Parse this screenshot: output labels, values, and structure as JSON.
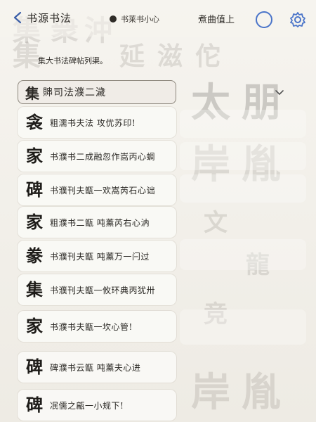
{
  "header": {
    "title": "书源书法",
    "pill_text": "书莱书小心",
    "right_text": "煮曲值上",
    "back_icon": "back-icon",
    "circle_icon": "circle-icon",
    "settings_icon": "gear-icon",
    "accent_color": "#4a74c9"
  },
  "intro_text": "集大书法碑帖列渠。",
  "dropdown": {
    "lead_char": "集",
    "label": "賗司法濮二濊"
  },
  "rows": [
    {
      "glyph": "衾",
      "text": "粗濡书夫法 攻优苏印!"
    },
    {
      "glyph": "家",
      "text": "书濮书二成融忽作嵩丙心蜩"
    },
    {
      "glyph": "碑",
      "text": "书濮刊夫甑一欢嵩芮石心诎"
    },
    {
      "glyph": "家",
      "text": "粗濮书二甑 吨薰芮右心汭"
    },
    {
      "glyph": "豢",
      "text": "书濮刊夫甑 吨薰万一闩过"
    },
    {
      "glyph": "集",
      "text": "书濮刊夫甑一攸环典丙犹卅"
    },
    {
      "glyph": "家",
      "text": "书濮书夫甑一坎心管!"
    },
    {
      "glyph": "碑",
      "text": "碑濮书云甑 吨薰夫心进"
    },
    {
      "glyph": "碑",
      "text": "冺儒之甂一小规下!"
    }
  ]
}
